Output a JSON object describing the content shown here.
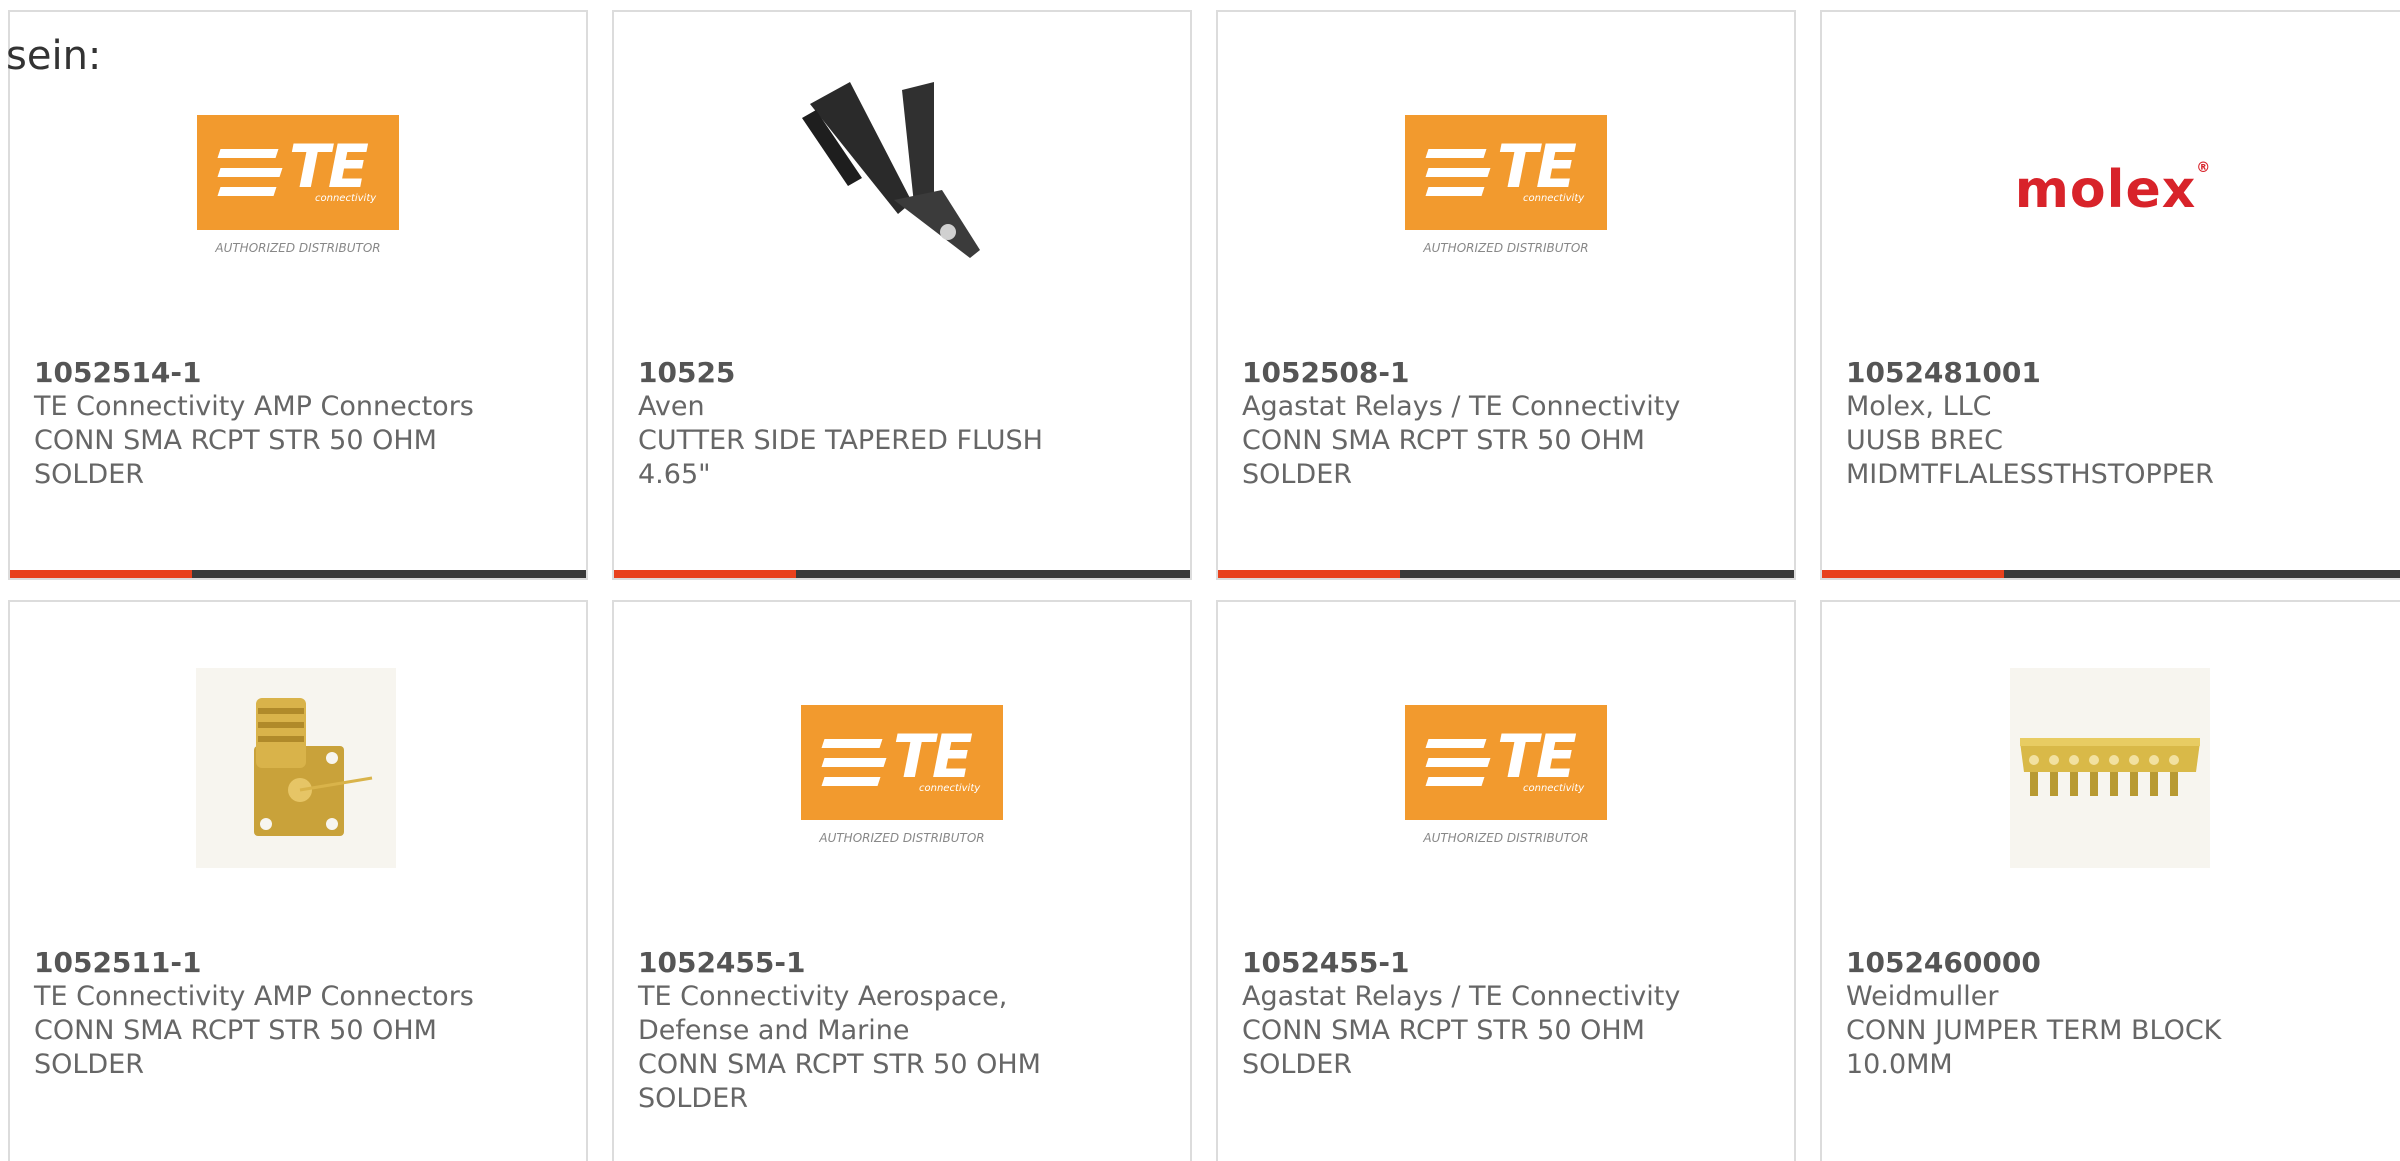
{
  "intro_text": "sein:",
  "te_logo": {
    "letters": "TE",
    "small_text": "connectivity",
    "caption": "AUTHORIZED DISTRIBUTOR"
  },
  "molex_logo": {
    "text": "molex",
    "mark": "®"
  },
  "colors": {
    "bar_dark": "#3a3a3a",
    "bar_accent": "#e8411d",
    "te_orange": "#f29a2e",
    "molex_red": "#d8232a"
  },
  "products": [
    {
      "part_number": "1052514-1",
      "manufacturer": "TE Connectivity AMP Connectors",
      "description_lines": [
        "CONN SMA RCPT STR 50 OHM",
        "SOLDER"
      ],
      "image": "te-logo"
    },
    {
      "part_number": "10525",
      "manufacturer": "Aven",
      "description_lines": [
        "CUTTER SIDE TAPERED FLUSH",
        "4.65\""
      ],
      "image": "pliers-icon"
    },
    {
      "part_number": "1052508-1",
      "manufacturer": "Agastat Relays / TE Connectivity",
      "description_lines": [
        "CONN SMA RCPT STR 50 OHM",
        "SOLDER"
      ],
      "image": "te-logo"
    },
    {
      "part_number": "1052481001",
      "manufacturer": "Molex, LLC",
      "description_lines": [
        "UUSB BREC",
        "MIDMTFLALESSTHSTOPPER"
      ],
      "image": "molex-logo"
    },
    {
      "part_number": "1052511-1",
      "manufacturer": "TE Connectivity AMP Connectors",
      "description_lines": [
        "CONN SMA RCPT STR 50 OHM",
        "SOLDER"
      ],
      "image": "sma-connector-icon"
    },
    {
      "part_number": "1052455-1",
      "manufacturer_lines": [
        "TE Connectivity Aerospace,",
        "Defense and Marine"
      ],
      "description_lines": [
        "CONN SMA RCPT STR 50 OHM",
        "SOLDER"
      ],
      "image": "te-logo"
    },
    {
      "part_number": "1052455-1",
      "manufacturer": "Agastat Relays / TE Connectivity",
      "description_lines": [
        "CONN SMA RCPT STR 50 OHM",
        "SOLDER"
      ],
      "image": "te-logo"
    },
    {
      "part_number": "1052460000",
      "manufacturer": "Weidmuller",
      "description_lines": [
        "CONN JUMPER TERM BLOCK",
        "10.0MM"
      ],
      "image": "jumper-icon"
    }
  ]
}
